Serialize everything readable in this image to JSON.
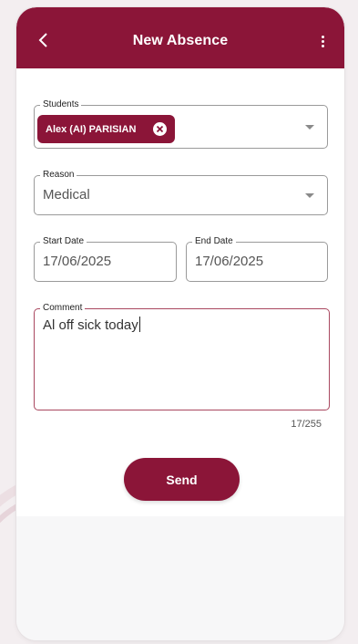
{
  "header": {
    "title": "New Absence",
    "back_icon": "chevron-left-icon",
    "menu_icon": "more-vert-icon"
  },
  "form": {
    "students": {
      "label": "Students",
      "chip_label": "Alex (AI) PARISIAN"
    },
    "reason": {
      "label": "Reason",
      "value": "Medical"
    },
    "start_date": {
      "label": "Start Date",
      "value": "17/06/2025"
    },
    "end_date": {
      "label": "End Date",
      "value": "17/06/2025"
    },
    "comment": {
      "label": "Comment",
      "value": "Al off sick today",
      "counter": "17/255"
    },
    "send_label": "Send"
  },
  "colors": {
    "brand": "#8b1538",
    "focus_border": "#a9475f"
  }
}
